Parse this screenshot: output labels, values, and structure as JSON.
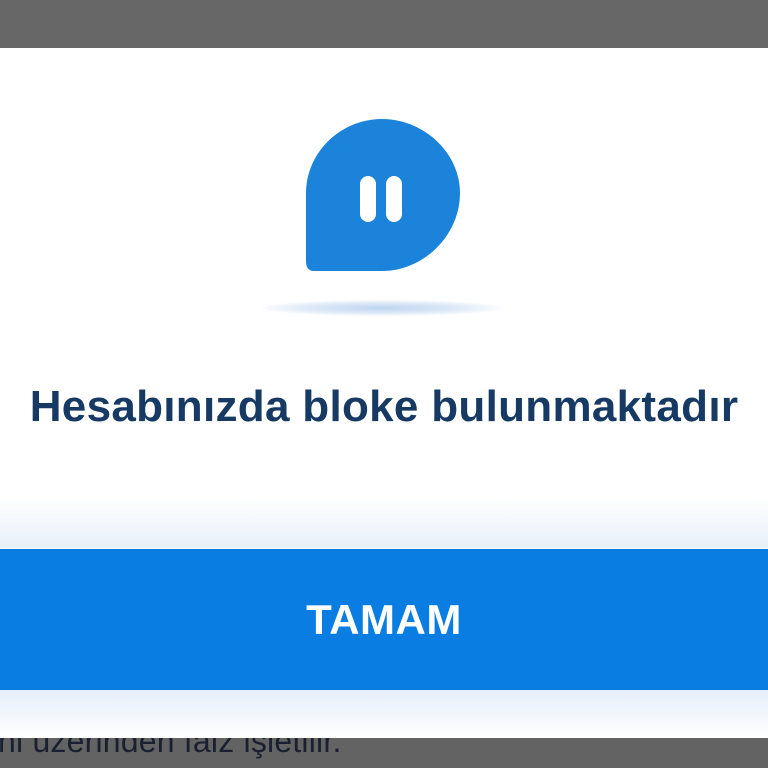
{
  "dialog": {
    "icon": "pause-chat-bubble-icon",
    "message": "Hesabınızda bloke bulunmaktadır",
    "ok_button_label": "TAMAM"
  },
  "background": {
    "partial_text": "ni üzerinden faiz işletilir."
  },
  "colors": {
    "accent": "#0a7de2",
    "message_text": "#163a63",
    "icon_fill": "#1b84da",
    "overlay": "#646464",
    "modal_background": "#ffffff"
  }
}
